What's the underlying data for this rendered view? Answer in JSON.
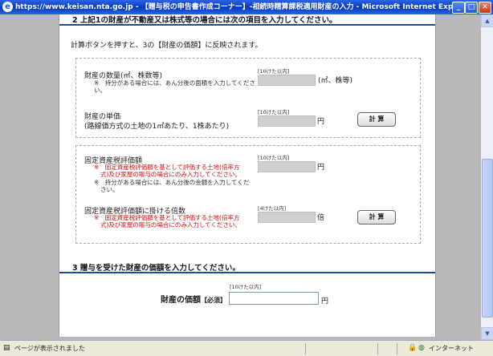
{
  "window": {
    "title": "https://www.keisan.nta.go.jp - 【贈与税の申告書作成コーナー】-相続時精算課税適用財産の入力 - Microsoft Internet Explorer",
    "buttons": {
      "minimize": "_",
      "maximize": "□",
      "close": "✕"
    }
  },
  "section2": {
    "heading": "2 上記1の財産が不動産又は株式等の場合には次の項目を入力してください。",
    "instruction": "計算ボタンを押すと、3の【財産の価額】に反映されます。",
    "box1": {
      "quantity": {
        "label": "財産の数量(㎡、株数等)",
        "note_line1": "※　持分がある場合には、あん分後の面積を入力してくださ",
        "note_line2": "い。",
        "limit": "[10けた以内]",
        "unit": "(㎡、株等)"
      },
      "unit_price": {
        "label_line1": "財産の単価",
        "label_line2": "(路線価方式の土地の1㎡あたり、1株あたり)",
        "limit": "[10けた以内]",
        "unit": "円",
        "button": "計 算"
      }
    },
    "box2": {
      "assessed_value": {
        "label": "固定資産税評価額",
        "note_red_line1": "※　固定資産税評価額を基として評価する土地(倍率方",
        "note_red_line2": "式)及び家屋の贈与の場合にのみ入力してください。",
        "note_line1": "※　持分がある場合には、あん分後の金額を入力してくだ",
        "note_line2": "さい。",
        "limit": "[10けた以内]",
        "unit": "円"
      },
      "multiplier": {
        "label": "固定資産税評価額に掛ける倍数",
        "note_red_line1": "※　固定資産税評価額を基として評価する土地(倍率方",
        "note_red_line2": "式)及び家屋の贈与の場合にのみ入力してください。",
        "limit": "[4けた以内]",
        "unit": "倍",
        "button": "計 算"
      }
    }
  },
  "section3": {
    "heading": "3 贈与を受けた財産の価額を入力してください。",
    "value_label": "財産の価額",
    "required": "【必須】",
    "limit": "[10けた以内]",
    "unit": "円"
  },
  "statusbar": {
    "text": "ページが表示されました",
    "zone": "インターネット"
  }
}
